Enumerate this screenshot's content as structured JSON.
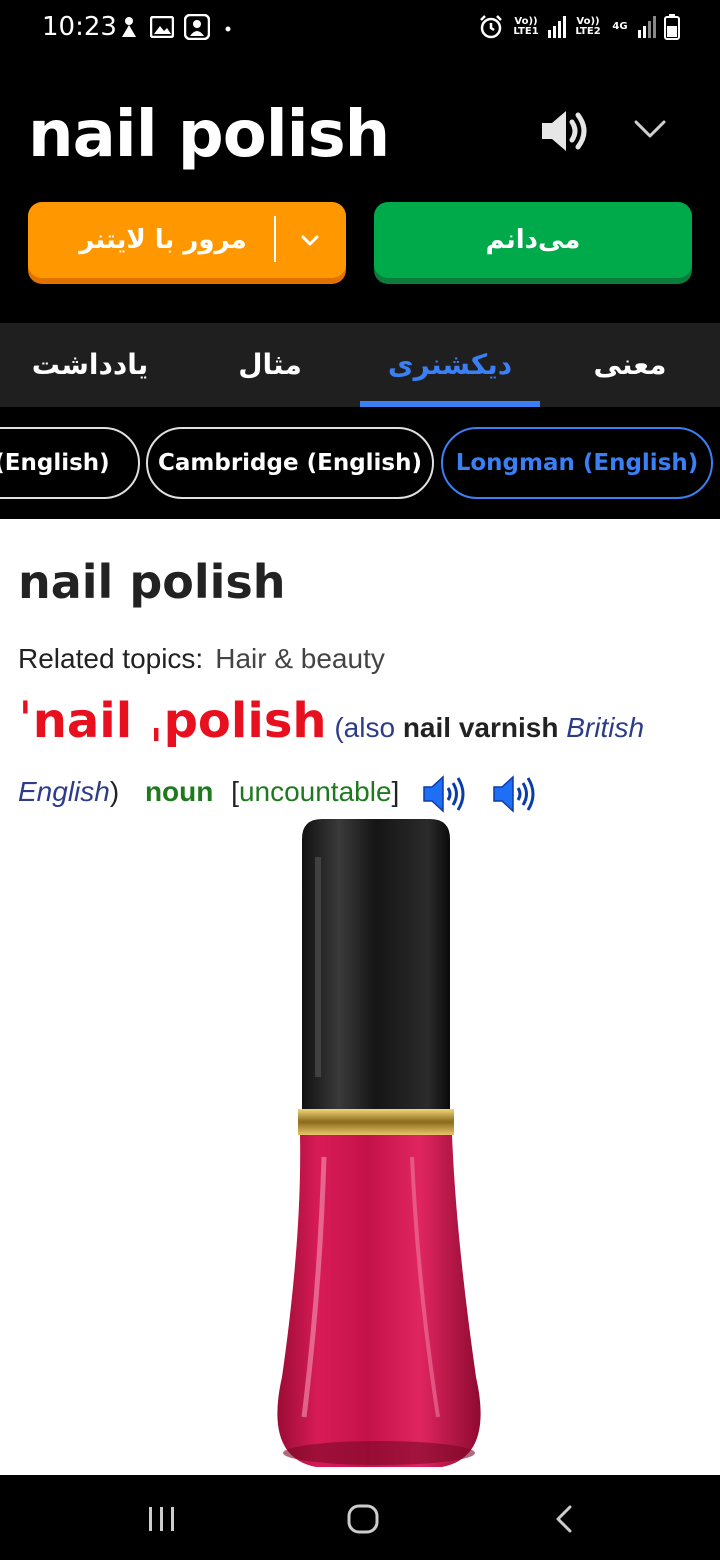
{
  "status_bar": {
    "time": "10:23",
    "net1": "Vo)) LTE1",
    "net2": "Vo)) LTE2",
    "net_type": "4G"
  },
  "header": {
    "word": "nail polish",
    "review_button": "مرور با لایتنر",
    "know_button": "می‌دانم"
  },
  "tabs": [
    "یادداشت",
    "مثال",
    "دیکشنری",
    "معنی"
  ],
  "active_tab": "دیکشنری",
  "dictionary_chips": [
    "Oxford (English)",
    "Cambridge (English)",
    "Longman (English)"
  ],
  "active_chip": "Longman (English)",
  "entry": {
    "word": "nail polish",
    "related_label": "Related topics:",
    "related_topic": "Hair & beauty",
    "pronunciation": "ˈnail ˌpolish",
    "also_prefix": "(also",
    "alt_word": "nail varnish",
    "region": "British English",
    "close_paren": ")",
    "pos": "noun",
    "grammar": "uncountable",
    "grammar_open": "[",
    "grammar_close": "]"
  },
  "colors": {
    "accent_blue": "#3b7ff5",
    "review_orange": "#ff9800",
    "know_green": "#00a94a",
    "pron_red": "#e8101e"
  },
  "icons": [
    "speaker-icon",
    "chevron-down-icon",
    "audio-british-icon",
    "audio-american-icon",
    "recents-icon",
    "home-icon",
    "back-icon"
  ]
}
